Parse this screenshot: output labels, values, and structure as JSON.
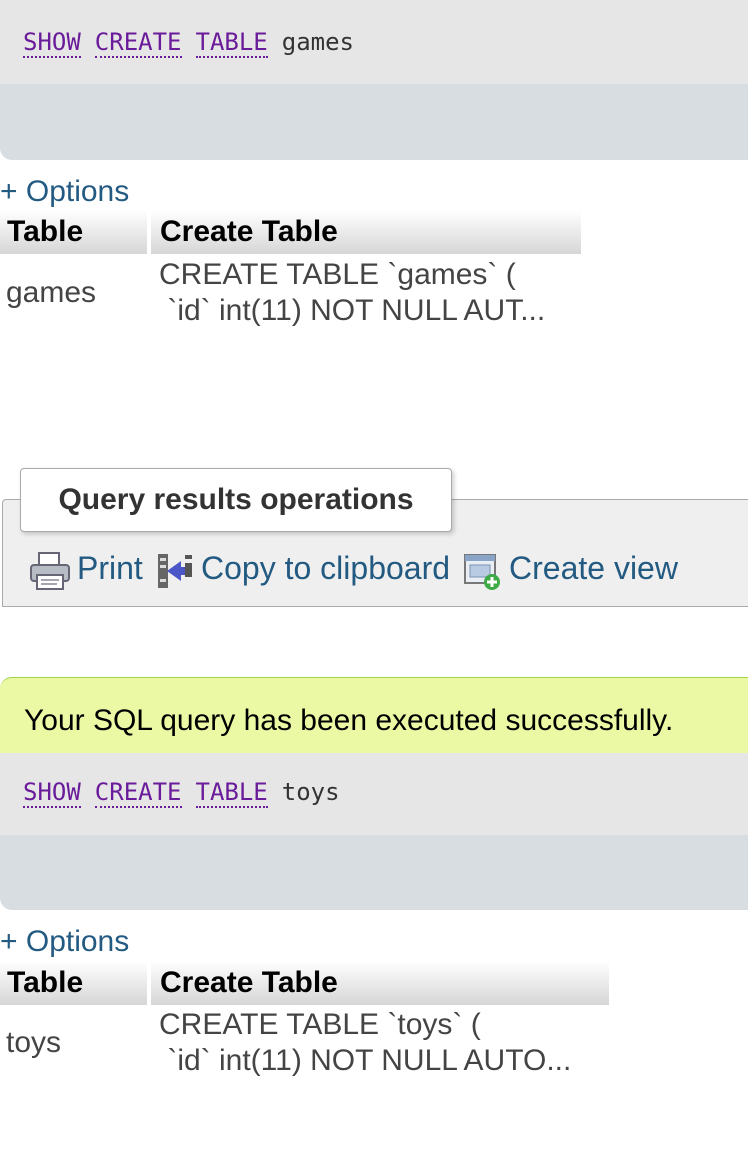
{
  "query1": {
    "keywords": [
      "SHOW",
      "CREATE",
      "TABLE"
    ],
    "table_name": "games"
  },
  "result1": {
    "options_label": "+ Options",
    "headers": [
      "Table",
      "Create Table"
    ],
    "row": {
      "table": "games",
      "create_line1": "CREATE TABLE `games` (",
      "create_line2": " `id` int(11) NOT NULL AUT..."
    }
  },
  "operations": {
    "legend": "Query results operations",
    "print_label": "Print",
    "copy_label": "Copy to clipboard",
    "create_view_label": "Create view"
  },
  "message": {
    "success_text": "Your SQL query has been executed successfully.",
    "success_color": "#ebf8a4"
  },
  "query2": {
    "keywords": [
      "SHOW",
      "CREATE",
      "TABLE"
    ],
    "table_name": "toys"
  },
  "result2": {
    "options_label": "+ Options",
    "headers": [
      "Table",
      "Create Table"
    ],
    "row": {
      "table": "toys",
      "create_line1": "CREATE TABLE `toys` (",
      "create_line2": " `id` int(11) NOT NULL AUTO..."
    }
  },
  "colors": {
    "keyword": "#6a1b9a",
    "link": "#235a81",
    "code_bg": "#e6e6e6",
    "panel_foot_bg": "#d8dde2"
  }
}
